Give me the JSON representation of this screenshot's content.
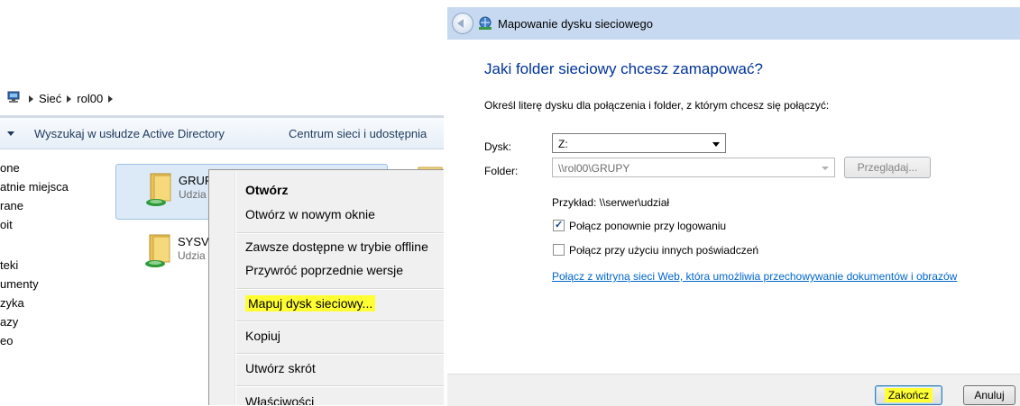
{
  "colors": {
    "highlight": "#ffff33",
    "link": "#0066cc",
    "heading": "#003399",
    "selection_bg": "#dceaf7"
  },
  "explorer": {
    "address": [
      "Sieć",
      "rol00"
    ],
    "commands": [
      "Wyszukaj w usłudze Active Directory",
      "Centrum sieci i udostępnia"
    ],
    "nav_items": [
      "one",
      "atnie miejsca",
      "rane",
      "oit",
      "teki",
      "umenty",
      "zyka",
      "azy",
      "eo"
    ],
    "shares": [
      {
        "name": "GRUF",
        "desc": "Udzia",
        "selected": true
      },
      {
        "name": "SYSV",
        "desc": "Udzia",
        "selected": false
      }
    ],
    "context_menu": {
      "open": "Otwórz",
      "open_new_window": "Otwórz w nowym oknie",
      "always_offline": "Zawsze dostępne w trybie offline",
      "restore_versions": "Przywróć poprzednie wersje",
      "map_drive": "Mapuj dysk sieciowy...",
      "copy": "Kopiuj",
      "create_shortcut": "Utwórz skrót",
      "properties": "Właściwości"
    }
  },
  "wizard": {
    "title": "Mapowanie dysku sieciowego",
    "heading": "Jaki folder sieciowy chcesz zamapować?",
    "instruction": "Określ literę dysku dla połączenia i folder, z którym chcesz się połączyć:",
    "drive_label": "Dysk:",
    "drive_value": "Z:",
    "folder_label": "Folder:",
    "folder_value": "\\\\rol00\\GRUPY",
    "browse_label": "Przeglądaj...",
    "example": "Przykład: \\\\serwer\\udział",
    "reconnect_label": "Połącz ponownie przy logowaniu",
    "reconnect_checked": true,
    "other_credentials_label": "Połącz przy użyciu innych poświadczeń",
    "other_credentials_checked": false,
    "web_link": "Połącz z witryną sieci Web, która umożliwia przechowywanie dokumentów i obrazów",
    "finish_label": "Zakończ",
    "cancel_label": "Anuluj"
  }
}
